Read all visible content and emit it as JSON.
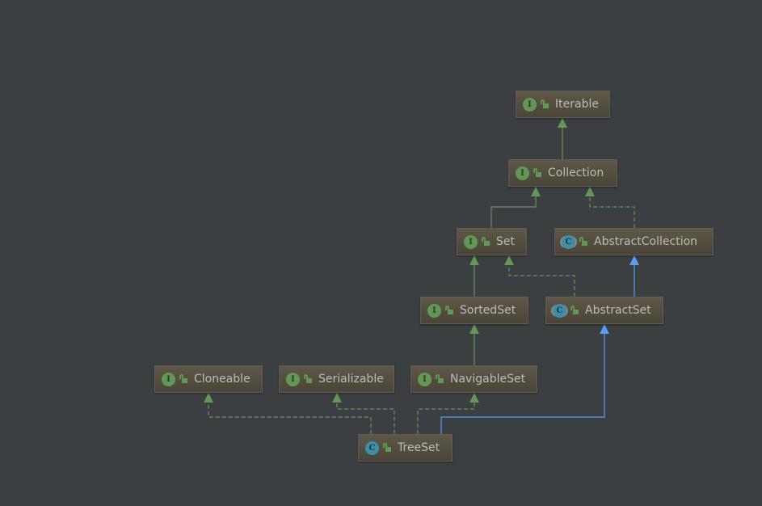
{
  "nodes": [
    {
      "id": "Iterable",
      "label": "Iterable",
      "kind": "interface"
    },
    {
      "id": "Collection",
      "label": "Collection",
      "kind": "interface"
    },
    {
      "id": "Set",
      "label": "Set",
      "kind": "interface"
    },
    {
      "id": "AbstractCollection",
      "label": "AbstractCollection",
      "kind": "abstract-class"
    },
    {
      "id": "SortedSet",
      "label": "SortedSet",
      "kind": "interface"
    },
    {
      "id": "AbstractSet",
      "label": "AbstractSet",
      "kind": "abstract-class"
    },
    {
      "id": "Cloneable",
      "label": "Cloneable",
      "kind": "interface"
    },
    {
      "id": "Serializable",
      "label": "Serializable",
      "kind": "interface"
    },
    {
      "id": "NavigableSet",
      "label": "NavigableSet",
      "kind": "interface"
    },
    {
      "id": "TreeSet",
      "label": "TreeSet",
      "kind": "class"
    }
  ],
  "kind_letters": {
    "interface": "I",
    "class": "C",
    "abstract-class": "C"
  },
  "edges": [
    {
      "from": "Collection",
      "to": "Iterable",
      "type": "extends-interface"
    },
    {
      "from": "Set",
      "to": "Collection",
      "type": "extends-interface"
    },
    {
      "from": "AbstractCollection",
      "to": "Collection",
      "type": "implements"
    },
    {
      "from": "SortedSet",
      "to": "Set",
      "type": "extends-interface"
    },
    {
      "from": "AbstractSet",
      "to": "Set",
      "type": "implements"
    },
    {
      "from": "AbstractSet",
      "to": "AbstractCollection",
      "type": "extends-class"
    },
    {
      "from": "NavigableSet",
      "to": "SortedSet",
      "type": "extends-interface"
    },
    {
      "from": "TreeSet",
      "to": "AbstractSet",
      "type": "extends-class"
    },
    {
      "from": "TreeSet",
      "to": "NavigableSet",
      "type": "implements"
    },
    {
      "from": "TreeSet",
      "to": "Serializable",
      "type": "implements"
    },
    {
      "from": "TreeSet",
      "to": "Cloneable",
      "type": "implements"
    }
  ],
  "colors": {
    "interface_edge": "#629755",
    "class_edge": "#589df6",
    "background": "#3c3f41"
  }
}
